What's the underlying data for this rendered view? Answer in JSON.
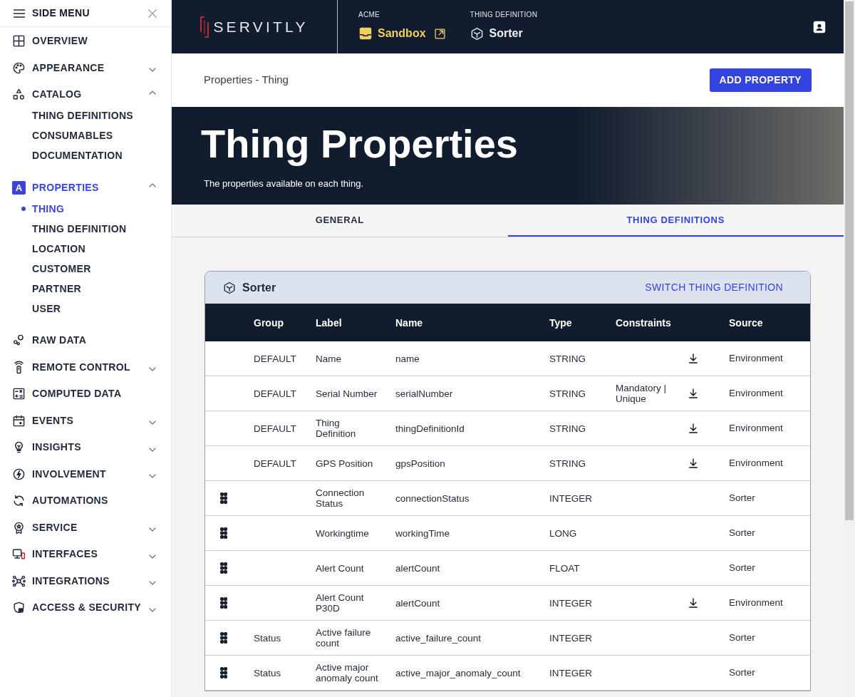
{
  "side_menu": {
    "title": "SIDE MENU",
    "items": [
      {
        "label": "OVERVIEW",
        "kind": "link",
        "selected": false
      },
      {
        "label": "APPEARANCE",
        "kind": "expandable",
        "expanded": false,
        "selected": false
      },
      {
        "label": "CATALOG",
        "kind": "expandable",
        "expanded": true,
        "selected": false,
        "children": [
          {
            "label": "THING DEFINITIONS",
            "selected": false
          },
          {
            "label": "CONSUMABLES",
            "selected": false
          },
          {
            "label": "DOCUMENTATION",
            "selected": false
          }
        ]
      },
      {
        "label": "PROPERTIES",
        "icon_letter": "A",
        "kind": "expandable",
        "expanded": true,
        "selected": true,
        "children": [
          {
            "label": "THING",
            "selected": true
          },
          {
            "label": "THING DEFINITION",
            "selected": false
          },
          {
            "label": "LOCATION",
            "selected": false
          },
          {
            "label": "CUSTOMER",
            "selected": false
          },
          {
            "label": "PARTNER",
            "selected": false
          },
          {
            "label": "USER",
            "selected": false
          }
        ]
      },
      {
        "label": "RAW DATA",
        "kind": "link",
        "selected": false
      },
      {
        "label": "REMOTE CONTROL",
        "kind": "expandable",
        "expanded": false,
        "selected": false
      },
      {
        "label": "COMPUTED DATA",
        "kind": "link",
        "selected": false
      },
      {
        "label": "EVENTS",
        "kind": "expandable",
        "expanded": false,
        "selected": false
      },
      {
        "label": "INSIGHTS",
        "kind": "expandable",
        "expanded": false,
        "selected": false
      },
      {
        "label": "INVOLVEMENT",
        "kind": "expandable",
        "expanded": false,
        "selected": false
      },
      {
        "label": "AUTOMATIONS",
        "kind": "link",
        "selected": false
      },
      {
        "label": "SERVICE",
        "kind": "expandable",
        "expanded": false,
        "selected": false
      },
      {
        "label": "INTERFACES",
        "kind": "expandable",
        "expanded": false,
        "selected": false
      },
      {
        "label": "INTEGRATIONS",
        "kind": "expandable",
        "expanded": false,
        "selected": false
      },
      {
        "label": "ACCESS & SECURITY",
        "kind": "expandable",
        "expanded": false,
        "selected": false
      }
    ]
  },
  "header": {
    "logo": "SERVITLY",
    "tenant_label": "ACME",
    "tenant": "Sandbox",
    "definition_label": "THING DEFINITION",
    "definition": "Sorter"
  },
  "breadcrumb": "Properties - Thing",
  "add_button": "ADD PROPERTY",
  "hero": {
    "title": "Thing Properties",
    "subtitle": "The properties available on each thing."
  },
  "tabs": [
    {
      "label": "GENERAL",
      "selected": false
    },
    {
      "label": "THING DEFINITIONS",
      "selected": true
    }
  ],
  "card": {
    "title": "Sorter",
    "switch_link": "SWITCH THING DEFINITION"
  },
  "table": {
    "columns": [
      "Group",
      "Label",
      "Name",
      "Type",
      "Constraints",
      "Source"
    ],
    "rows": [
      {
        "draggable": false,
        "group": "DEFAULT",
        "label": "Name",
        "name": "name",
        "type": "STRING",
        "constraints": "",
        "inherited": true,
        "source": "Environment"
      },
      {
        "draggable": false,
        "group": "DEFAULT",
        "label": "Serial Number",
        "name": "serialNumber",
        "type": "STRING",
        "constraints": "Mandatory | Unique",
        "inherited": true,
        "source": "Environment"
      },
      {
        "draggable": false,
        "group": "DEFAULT",
        "label": "Thing Definition",
        "name": "thingDefinitionId",
        "type": "STRING",
        "constraints": "",
        "inherited": true,
        "source": "Environment"
      },
      {
        "draggable": false,
        "group": "DEFAULT",
        "label": "GPS Position",
        "name": "gpsPosition",
        "type": "STRING",
        "constraints": "",
        "inherited": true,
        "source": "Environment"
      },
      {
        "draggable": true,
        "group": "",
        "label": "Connection Status",
        "name": "connectionStatus",
        "type": "INTEGER",
        "constraints": "",
        "inherited": false,
        "source": "Sorter"
      },
      {
        "draggable": true,
        "group": "",
        "label": "Workingtime",
        "name": "workingTime",
        "type": "LONG",
        "constraints": "",
        "inherited": false,
        "source": "Sorter"
      },
      {
        "draggable": true,
        "group": "",
        "label": "Alert Count",
        "name": "alertCount",
        "type": "FLOAT",
        "constraints": "",
        "inherited": false,
        "source": "Sorter"
      },
      {
        "draggable": true,
        "group": "",
        "label": "Alert Count P30D",
        "name": "alertCount",
        "type": "INTEGER",
        "constraints": "",
        "inherited": true,
        "source": "Environment"
      },
      {
        "draggable": true,
        "group": "Status",
        "label": "Active failure count",
        "name": "active_failure_count",
        "type": "INTEGER",
        "constraints": "",
        "inherited": false,
        "source": "Sorter"
      },
      {
        "draggable": true,
        "group": "Status",
        "label": "Active major anomaly count",
        "name": "active_major_anomaly_count",
        "type": "INTEGER",
        "constraints": "",
        "inherited": false,
        "source": "Sorter"
      }
    ]
  }
}
